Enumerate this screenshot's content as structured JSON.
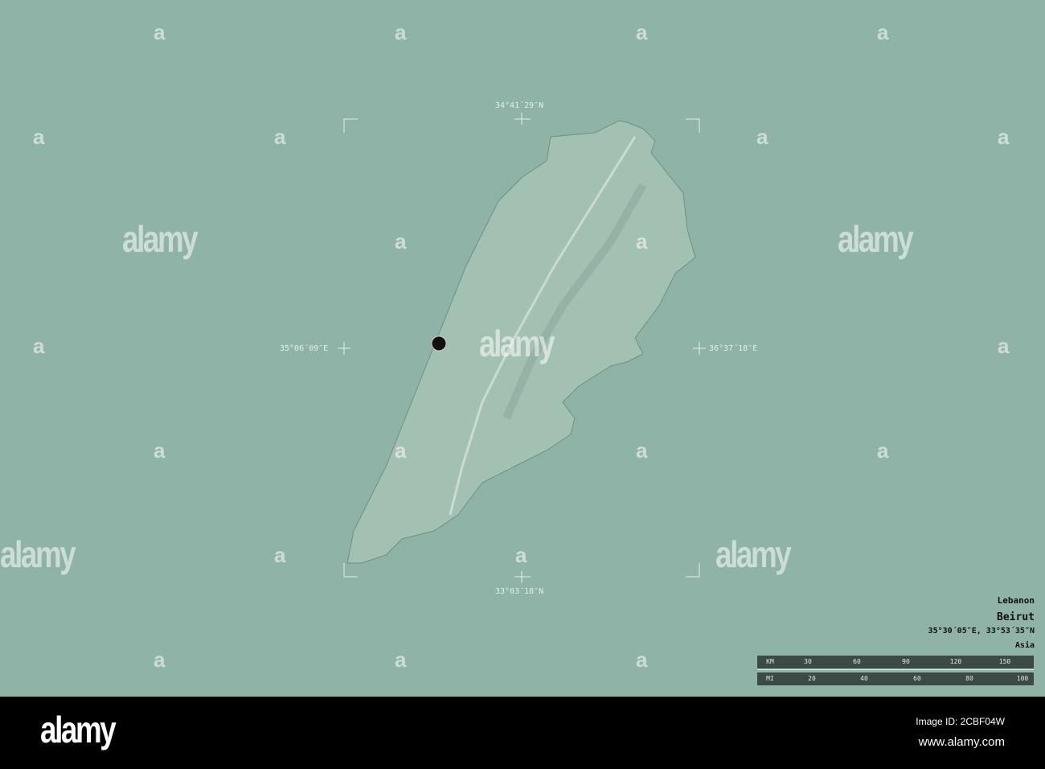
{
  "map": {
    "country": "Lebanon",
    "capital": "Beirut",
    "capital_coords": "35°30´05″E, 33°53´35″N",
    "continent": "Asia",
    "bounds": {
      "north": "34°41´29″N",
      "south": "33°03´18″N",
      "west": "35°06´09″E",
      "east": "36°37´18″E"
    },
    "colors": {
      "background": "#8fb3a7",
      "land": "#a7c4b6",
      "marker": "#111111"
    }
  },
  "scale": {
    "km_label": "KM",
    "km_ticks": [
      "30",
      "60",
      "90",
      "120",
      "150"
    ],
    "mi_label": "MI",
    "mi_ticks": [
      "20",
      "40",
      "60",
      "80",
      "100"
    ]
  },
  "watermark": {
    "big": "alamy",
    "small": "a"
  },
  "footer": {
    "logo": "alamy",
    "image_id": "Image ID: 2CBF04W",
    "url": "www.alamy.com"
  }
}
